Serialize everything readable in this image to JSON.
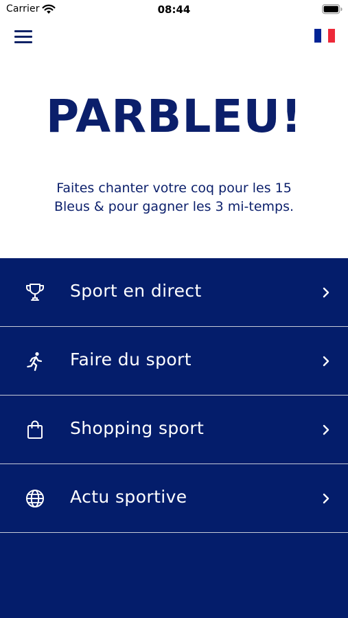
{
  "status_bar": {
    "carrier": "Carrier",
    "time": "08:44"
  },
  "header": {
    "menu_icon": "hamburger-menu-icon",
    "language_flag": "flag-france-icon",
    "flag_colors": [
      "#002395",
      "#FFFFFF",
      "#ED2939"
    ]
  },
  "hero": {
    "title": "PARBLEU!",
    "subtitle": "Faites chanter votre coq pour les 15 Bleus & pour gagner les 3 mi-temps."
  },
  "menu": {
    "items": [
      {
        "label": "Sport en direct",
        "icon": "trophy-icon"
      },
      {
        "label": "Faire du sport",
        "icon": "running-person-icon"
      },
      {
        "label": "Shopping sport",
        "icon": "shopping-bag-icon"
      },
      {
        "label": "Actu sportive",
        "icon": "globe-icon"
      }
    ]
  },
  "colors": {
    "brand_blue": "#0b1f6b",
    "panel_blue": "#041d6b",
    "divider": "#c7cbd8",
    "text_on_panel": "#ffffff"
  }
}
